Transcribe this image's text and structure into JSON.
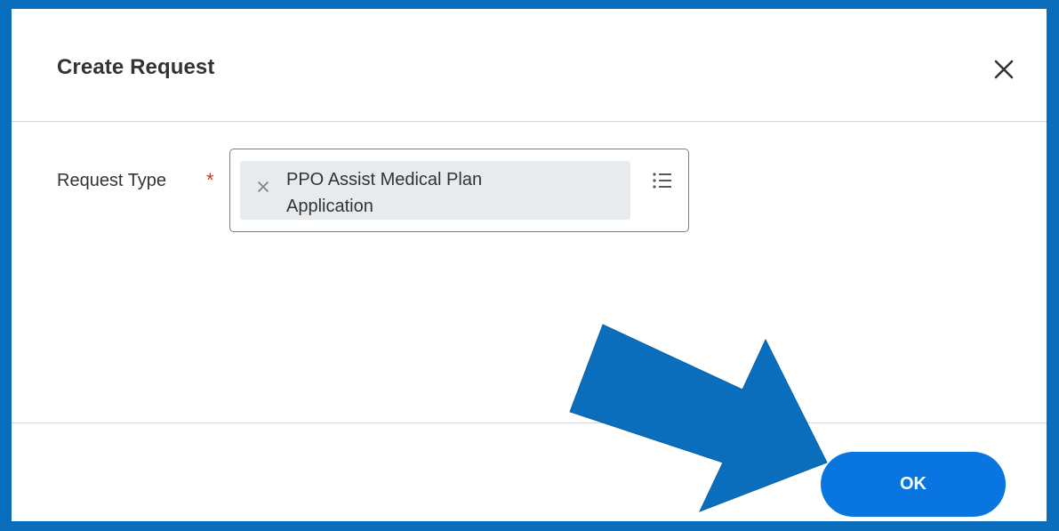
{
  "dialog": {
    "title": "Create Request",
    "close_icon": "close-icon"
  },
  "form": {
    "request_type": {
      "label": "Request Type",
      "required_marker": "*",
      "selected_value": "PPO Assist Medical Plan Application",
      "remove_icon": "remove-x-icon",
      "prompt_icon": "list-icon"
    }
  },
  "footer": {
    "ok_label": "OK"
  },
  "annotation": {
    "arrow_icon": "pointer-arrow-icon"
  },
  "colors": {
    "frame": "#0a6ebd",
    "primary_button": "#0875e1",
    "required": "#de2e21",
    "pill_background": "#e8ebee",
    "arrow": "#0a6ebd"
  }
}
